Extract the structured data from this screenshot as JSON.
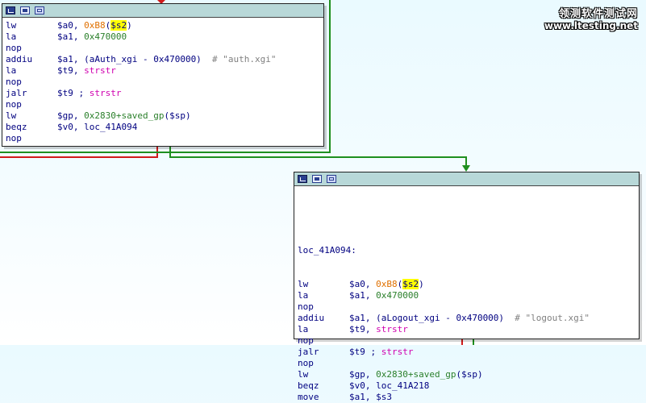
{
  "watermark": {
    "line1": "领测软件测试网",
    "line2": "www.ltesting.net"
  },
  "node1": {
    "lines": [
      {
        "mn": "lw",
        "parts": [
          {
            "t": "$a0, ",
            "c": "reg"
          },
          {
            "t": "0xB8",
            "c": "imm"
          },
          {
            "t": "(",
            "c": "reg"
          },
          {
            "t": "$s2",
            "c": "hl"
          },
          {
            "t": ")",
            "c": "reg"
          }
        ]
      },
      {
        "mn": "la",
        "parts": [
          {
            "t": "$a1, ",
            "c": "reg"
          },
          {
            "t": "0x470000",
            "c": "sym"
          }
        ]
      },
      {
        "mn": "nop",
        "parts": []
      },
      {
        "mn": "addiu",
        "parts": [
          {
            "t": "$a1, (aAuth_xgi - 0x470000)",
            "c": "reg"
          },
          {
            "t": "  # \"auth.xgi\"",
            "c": "cmt"
          }
        ]
      },
      {
        "mn": "la",
        "parts": [
          {
            "t": "$t9, ",
            "c": "reg"
          },
          {
            "t": "strstr",
            "c": "fn"
          }
        ]
      },
      {
        "mn": "nop",
        "parts": []
      },
      {
        "mn": "jalr",
        "parts": [
          {
            "t": "$t9 ; ",
            "c": "reg"
          },
          {
            "t": "strstr",
            "c": "fn"
          }
        ]
      },
      {
        "mn": "nop",
        "parts": []
      },
      {
        "mn": "lw",
        "parts": [
          {
            "t": "$gp, ",
            "c": "reg"
          },
          {
            "t": "0x2830+saved_gp",
            "c": "sym"
          },
          {
            "t": "($sp)",
            "c": "reg"
          }
        ]
      },
      {
        "mn": "beqz",
        "parts": [
          {
            "t": "$v0, loc_41A094",
            "c": "reg"
          }
        ]
      },
      {
        "mn": "nop",
        "parts": []
      }
    ]
  },
  "node2": {
    "label": "loc_41A094:",
    "lines": [
      {
        "mn": "lw",
        "parts": [
          {
            "t": "$a0, ",
            "c": "reg"
          },
          {
            "t": "0xB8",
            "c": "imm"
          },
          {
            "t": "(",
            "c": "reg"
          },
          {
            "t": "$s2",
            "c": "hl"
          },
          {
            "t": ")",
            "c": "reg"
          }
        ]
      },
      {
        "mn": "la",
        "parts": [
          {
            "t": "$a1, ",
            "c": "reg"
          },
          {
            "t": "0x470000",
            "c": "sym"
          }
        ]
      },
      {
        "mn": "nop",
        "parts": []
      },
      {
        "mn": "addiu",
        "parts": [
          {
            "t": "$a1, (aLogout_xgi - 0x470000)",
            "c": "reg"
          },
          {
            "t": "  # \"logout.xgi\"",
            "c": "cmt"
          }
        ]
      },
      {
        "mn": "la",
        "parts": [
          {
            "t": "$t9, ",
            "c": "reg"
          },
          {
            "t": "strstr",
            "c": "fn"
          }
        ]
      },
      {
        "mn": "nop",
        "parts": []
      },
      {
        "mn": "jalr",
        "parts": [
          {
            "t": "$t9 ; ",
            "c": "reg"
          },
          {
            "t": "strstr",
            "c": "fn"
          }
        ]
      },
      {
        "mn": "nop",
        "parts": []
      },
      {
        "mn": "lw",
        "parts": [
          {
            "t": "$gp, ",
            "c": "reg"
          },
          {
            "t": "0x2830+saved_gp",
            "c": "sym"
          },
          {
            "t": "($sp)",
            "c": "reg"
          }
        ]
      },
      {
        "mn": "beqz",
        "parts": [
          {
            "t": "$v0, loc_41A218",
            "c": "reg"
          }
        ]
      },
      {
        "mn": "move",
        "parts": [
          {
            "t": "$a1, $s3",
            "c": "reg"
          }
        ]
      }
    ]
  },
  "colors": {
    "edge_true": "#1f8f1f",
    "edge_false": "#d11a1a",
    "titlebar": "#b8d8d8"
  }
}
